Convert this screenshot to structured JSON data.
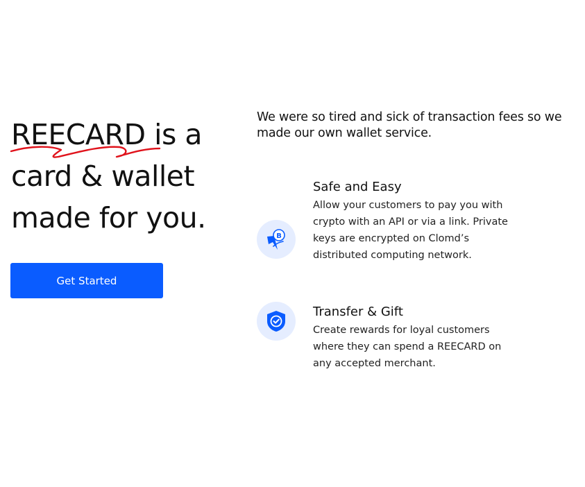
{
  "hero": {
    "brand": "REECARD",
    "headline_line1_rest": " is a",
    "headline_line2": "card & wallet",
    "headline_line3": "made for you.",
    "cta_label": "Get Started"
  },
  "intro": {
    "text": "We were so tired and sick of transaction fees so we made our own wallet service."
  },
  "features": [
    {
      "title": "Safe and Easy",
      "description": "Allow your customers to pay you with crypto with an API or via a link. Private keys are encrypted on Clomd’s distributed computing network.",
      "icon": "bitcoin-pen-icon"
    },
    {
      "title": "Transfer & Gift",
      "description": "Create rewards for loyal customers where they can spend a REECARD on any accepted merchant.",
      "icon": "shield-check-icon"
    }
  ],
  "colors": {
    "accent": "#0a5cff",
    "icon_bg": "#e5edff",
    "underline": "#e0121b",
    "text": "#111111"
  }
}
